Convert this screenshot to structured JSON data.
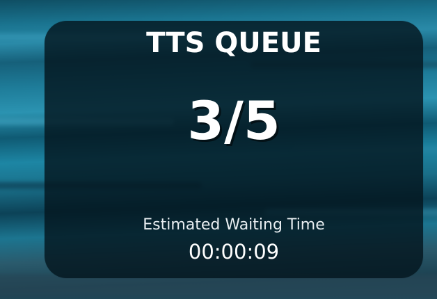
{
  "overlay": {
    "title": "TTS QUEUE",
    "queue_position": "3/5",
    "wait_label": "Estimated Waiting Time",
    "wait_time": "00:00:09"
  },
  "colors": {
    "card_background": "#04161e",
    "text": "#ffffff",
    "background_teal": "#1a7490"
  }
}
